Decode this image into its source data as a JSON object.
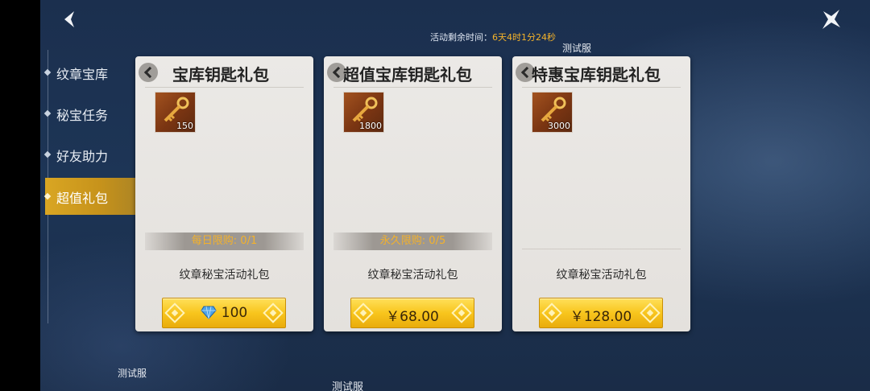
{
  "header": {
    "timer_label": "活动剩余时间：",
    "timer_value": "6天4时1分24秒",
    "back_icon": "back-arrow-icon",
    "close_icon": "close-x-icon"
  },
  "watermarks": [
    "测试服",
    "测试服",
    "测试服"
  ],
  "sidebar": {
    "items": [
      {
        "label": "纹章宝库",
        "active": false
      },
      {
        "label": "秘宝任务",
        "active": false
      },
      {
        "label": "好友助力",
        "active": false
      },
      {
        "label": "超值礼包",
        "active": true
      }
    ]
  },
  "cards": [
    {
      "title": "宝库钥匙礼包",
      "item": {
        "icon": "key-icon",
        "quantity": "150"
      },
      "limit": "每日限购: 0/1",
      "description": "纹章秘宝活动礼包",
      "price": "100",
      "price_icon": "diamond-gem-icon"
    },
    {
      "title": "超值宝库钥匙礼包",
      "item": {
        "icon": "key-icon",
        "quantity": "1800"
      },
      "limit": "永久限购: 0/5",
      "description": "纹章秘宝活动礼包",
      "price": "￥68.00"
    },
    {
      "title": "特惠宝库钥匙礼包",
      "item": {
        "icon": "key-icon",
        "quantity": "3000"
      },
      "limit": "",
      "description": "纹章秘宝活动礼包",
      "price": "￥128.00"
    }
  ],
  "colors": {
    "accent_gold": "#f8c51d",
    "limit_text": "#f3b12c",
    "timer_value": "#f5b32a",
    "active_tab": "#d9a623"
  }
}
